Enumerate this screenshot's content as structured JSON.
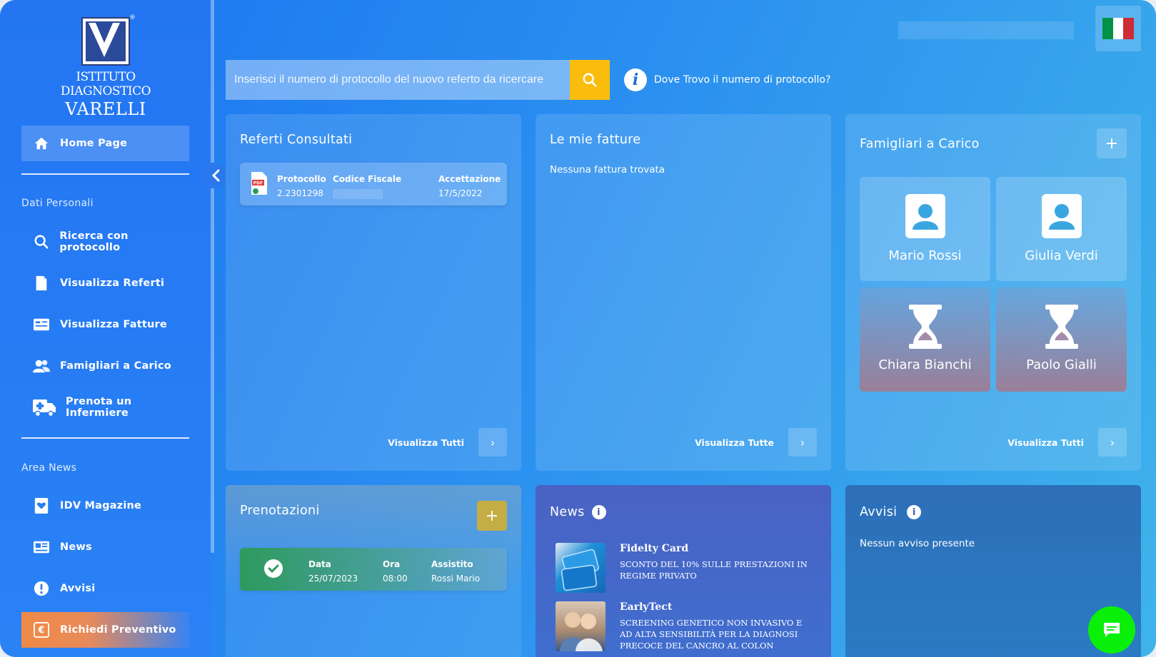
{
  "logo": {
    "line1": "ISTITUTO DIAGNOSTICO",
    "line2": "VARELLI",
    "reg": "®"
  },
  "sidebar": {
    "home": "Home Page",
    "section_personal": "Dati Personali",
    "items_personal": [
      {
        "label": "Ricerca con protocollo",
        "icon": "search-icon"
      },
      {
        "label": "Visualizza Referti",
        "icon": "file-icon"
      },
      {
        "label": "Visualizza Fatture",
        "icon": "invoice-icon"
      },
      {
        "label": "Famigliari a Carico",
        "icon": "users-icon"
      },
      {
        "label": "Prenota un Infermiere",
        "icon": "ambulance-icon"
      }
    ],
    "section_news": "Area News",
    "items_news": [
      {
        "label": "IDV Magazine",
        "icon": "magazine-icon"
      },
      {
        "label": "News",
        "icon": "newspaper-icon"
      },
      {
        "label": "Avvisi",
        "icon": "alert-icon"
      }
    ],
    "quote": "Richiedi Preventivo"
  },
  "search": {
    "placeholder": "Inserisci il numero di protocollo del nuovo referto da ricercare",
    "help": "Dove Trovo il numero di protocollo?"
  },
  "flag_colors": [
    "#009246",
    "#ffffff",
    "#ce2b37"
  ],
  "referti": {
    "title": "Referti Consultati",
    "headers": [
      "Protocollo",
      "Codice Fiscale",
      "Accettazione"
    ],
    "row": {
      "protocollo": "2.2301298",
      "codice": "",
      "accettazione": "17/5/2022"
    },
    "view_all": "Visualizza Tutti"
  },
  "fatture": {
    "title": "Le mie fatture",
    "empty": "Nessuna fattura trovata",
    "view_all": "Visualizza Tutte"
  },
  "famigliari": {
    "title": "Famigliari a Carico",
    "members": [
      {
        "name": "Mario Rossi",
        "status": "active"
      },
      {
        "name": "Giulia Verdi",
        "status": "active"
      },
      {
        "name": "Chiara Bianchi",
        "status": "pending"
      },
      {
        "name": "Paolo Gialli",
        "status": "pending"
      }
    ],
    "view_all": "Visualizza Tutti"
  },
  "prenotazioni": {
    "title": "Prenotazioni",
    "headers": [
      "Data",
      "Ora",
      "Assistito"
    ],
    "row": {
      "data": "25/07/2023",
      "ora": "08:00",
      "assistito": "Rossi Mario"
    }
  },
  "news": {
    "title": "News",
    "items": [
      {
        "title": "Fidelty Card",
        "desc": "SCONTO DEL 10% SULLE PRESTAZIONI IN REGIME PRIVATO"
      },
      {
        "title": "EarlyTect",
        "desc": "SCREENING GENETICO NON INVASIVO E AD ALTA SENSIBILITÀ PER LA DIAGNOSI PRECOCE DEL CANCRO AL COLON"
      }
    ]
  },
  "avvisi": {
    "title": "Avvisi",
    "empty": "Nessun avviso presente"
  },
  "colors": {
    "accent_yellow": "#fbbd0d",
    "success_green": "#2e9a5c",
    "chat_green": "#0af00a"
  }
}
